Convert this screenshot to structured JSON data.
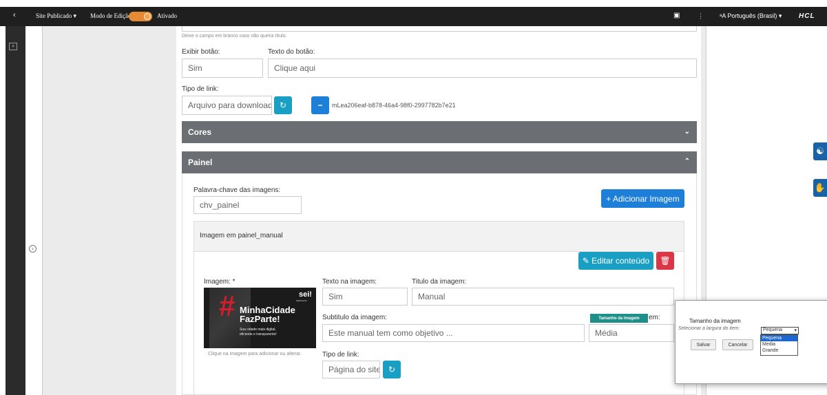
{
  "topbar": {
    "back_icon": "chevron-left-icon",
    "site_status": "Site Publicado",
    "edit_mode_label": "Modo de Edição:",
    "edit_mode_value": "Ativado",
    "language": "Português (Brasil)",
    "brand": "HCL",
    "accent_color": "#e58a33"
  },
  "sidebar": {
    "add_icon": "plus-square-icon",
    "toggle_icon": "circle-arrow-icon"
  },
  "form": {
    "title_hint": "Deixe o campo em branco caso não queira título.",
    "show_button_label": "Exibir botão:",
    "show_button_value": "Sim",
    "button_text_label": "Texto do botão:",
    "button_text_value": "Clique aqui",
    "link_type_label": "Tipo de link:",
    "link_type_value": "Arquivo para download",
    "file_id": "mLea206eaf-b878-46a4-98f0-2997782b7e21",
    "colors_section": "Cores",
    "panel_section": "Painel"
  },
  "panel": {
    "keyword_label": "Palavra-chave das imagens:",
    "keyword_value": "chv_painel",
    "add_image_button": "+ Adicionar Imagem",
    "item_header": "Imagem em painel_manual",
    "edit_content_button": "Editar conteúdo",
    "image_label": "Imagem: *",
    "image_caption": "Clique na imagem para adicionar ou alterar.",
    "image_text_label": "Texto na imagem:",
    "image_text_value": "Sim",
    "image_title_label": "Titulo da imagem:",
    "image_title_value": "Manual",
    "subtitle_label": "Subtitulo da imagem:",
    "subtitle_value": "Este manual tem como objetivo ...",
    "size_label_suffix": "em:",
    "size_value": "Média",
    "tooltip": "Tamanho da Imagem",
    "item_link_type_label": "Tipo de link:",
    "item_link_type_value": "Página do site"
  },
  "thumbnail": {
    "logo": "sei!",
    "logo_sub": "SERVIÇOS",
    "hashtag": "#",
    "line1": "MinhaCidade",
    "line2": "FazParte!",
    "desc1": "Sua cidade mais digital,",
    "desc2": "eficiente e transparente!"
  },
  "popup": {
    "title": "Tamanho da imagem",
    "select_label": "Selecionar a largura do item:",
    "selected": "Pequena",
    "options": [
      "Pequena",
      "Media",
      "Grande"
    ],
    "save": "Salvar",
    "cancel": "Cancelar"
  }
}
